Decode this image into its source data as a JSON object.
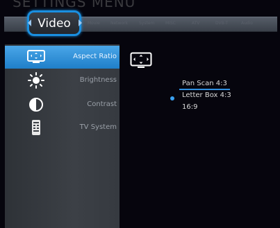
{
  "header": {
    "faded_title": "SETTINGS MENU"
  },
  "tabs": {
    "active": "Video",
    "inactive": [
      "Movie",
      "Network",
      "System",
      "MISC",
      "ATV",
      "DVB-T",
      "Audio"
    ]
  },
  "menu": {
    "items": [
      {
        "label": "Aspect Ratio",
        "icon": "aspect-ratio-icon",
        "selected": true
      },
      {
        "label": "Brightness",
        "icon": "brightness-icon",
        "selected": false
      },
      {
        "label": "Contrast",
        "icon": "contrast-icon",
        "selected": false
      },
      {
        "label": "TV System",
        "icon": "tv-system-icon",
        "selected": false
      }
    ]
  },
  "options": {
    "items": [
      "Pan Scan 4:3",
      "Letter Box 4:3",
      "16:9"
    ],
    "highlighted": "Pan Scan 4:3",
    "current": "Letter Box 4:3"
  },
  "colors": {
    "accent": "#1a8fe0",
    "selected_row": "#2f8ed8",
    "background": "#06050d"
  }
}
